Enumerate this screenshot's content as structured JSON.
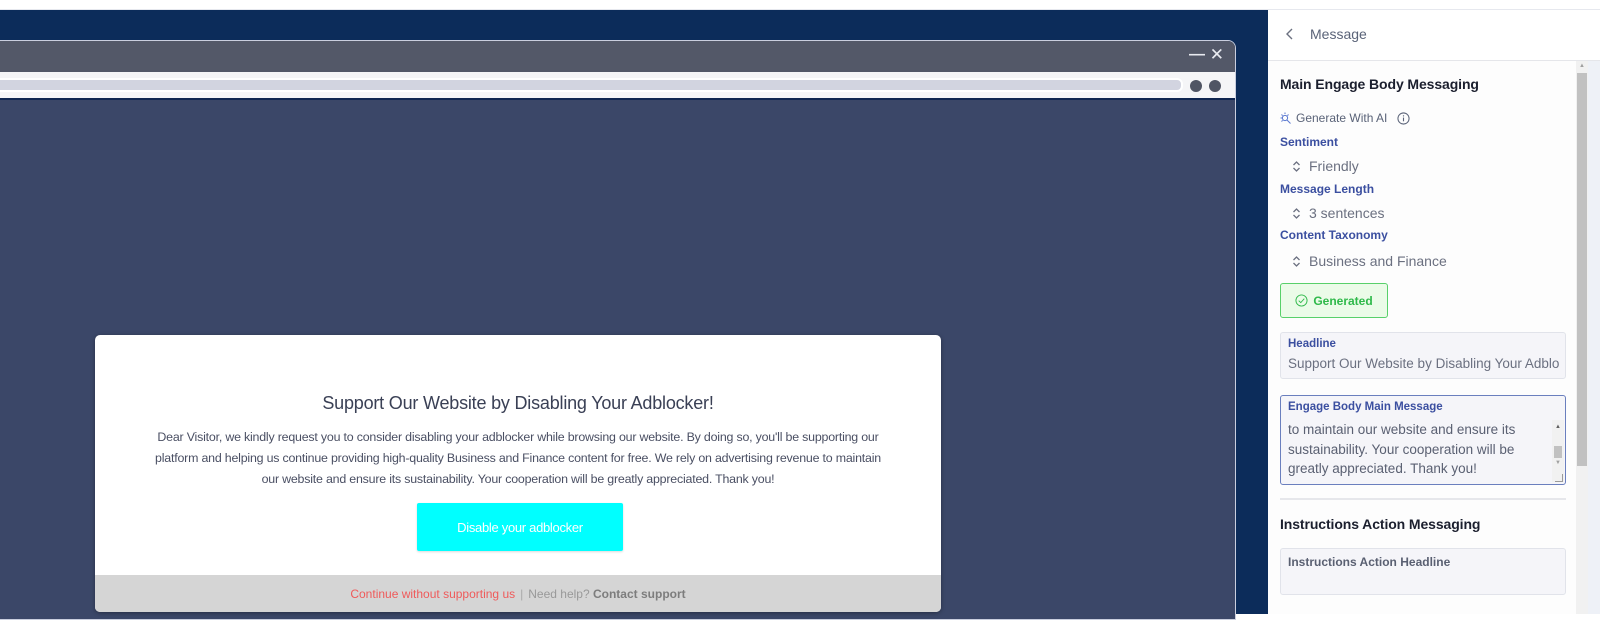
{
  "browser_mock": {
    "window_controls": {
      "minimize": "—",
      "close": "✕"
    }
  },
  "modal": {
    "title": "Support Our Website by Disabling Your Adblocker!",
    "body": "Dear Visitor, we kindly request you to consider disabling your adblocker while browsing our website. By doing so, you'll be supporting our platform and helping us continue providing high-quality Business and Finance content for free. We rely on advertising revenue to maintain our website and ensure its sustainability. Your cooperation will be greatly appreciated. Thank you!",
    "cta_label": "Disable your adblocker",
    "cta_color": "#00ffff",
    "footer": {
      "continue_link": "Continue without supporting us",
      "separator": "|",
      "need_help": "Need help?",
      "contact_link": "Contact support"
    }
  },
  "panel": {
    "header_title": "Message",
    "section_main": {
      "title": "Main Engage Body Messaging",
      "generate_ai_label": "Generate With AI",
      "sentiment": {
        "label": "Sentiment",
        "value": "Friendly"
      },
      "message_length": {
        "label": "Message Length",
        "value": "3 sentences"
      },
      "content_taxonomy": {
        "label": "Content Taxonomy",
        "value": "Business and Finance"
      },
      "status_button": "Generated",
      "headline": {
        "label": "Headline",
        "value": "Support Our Website by Disabling Your Adblocker!"
      },
      "body_message": {
        "label": "Engage Body Main Message",
        "visible_text": "to maintain our website and ensure its sustainability. Your cooperation will be greatly appreciated. Thank you!"
      }
    },
    "section_instructions": {
      "title": "Instructions Action Messaging",
      "headline_label": "Instructions Action Headline",
      "headline_value": ""
    }
  }
}
